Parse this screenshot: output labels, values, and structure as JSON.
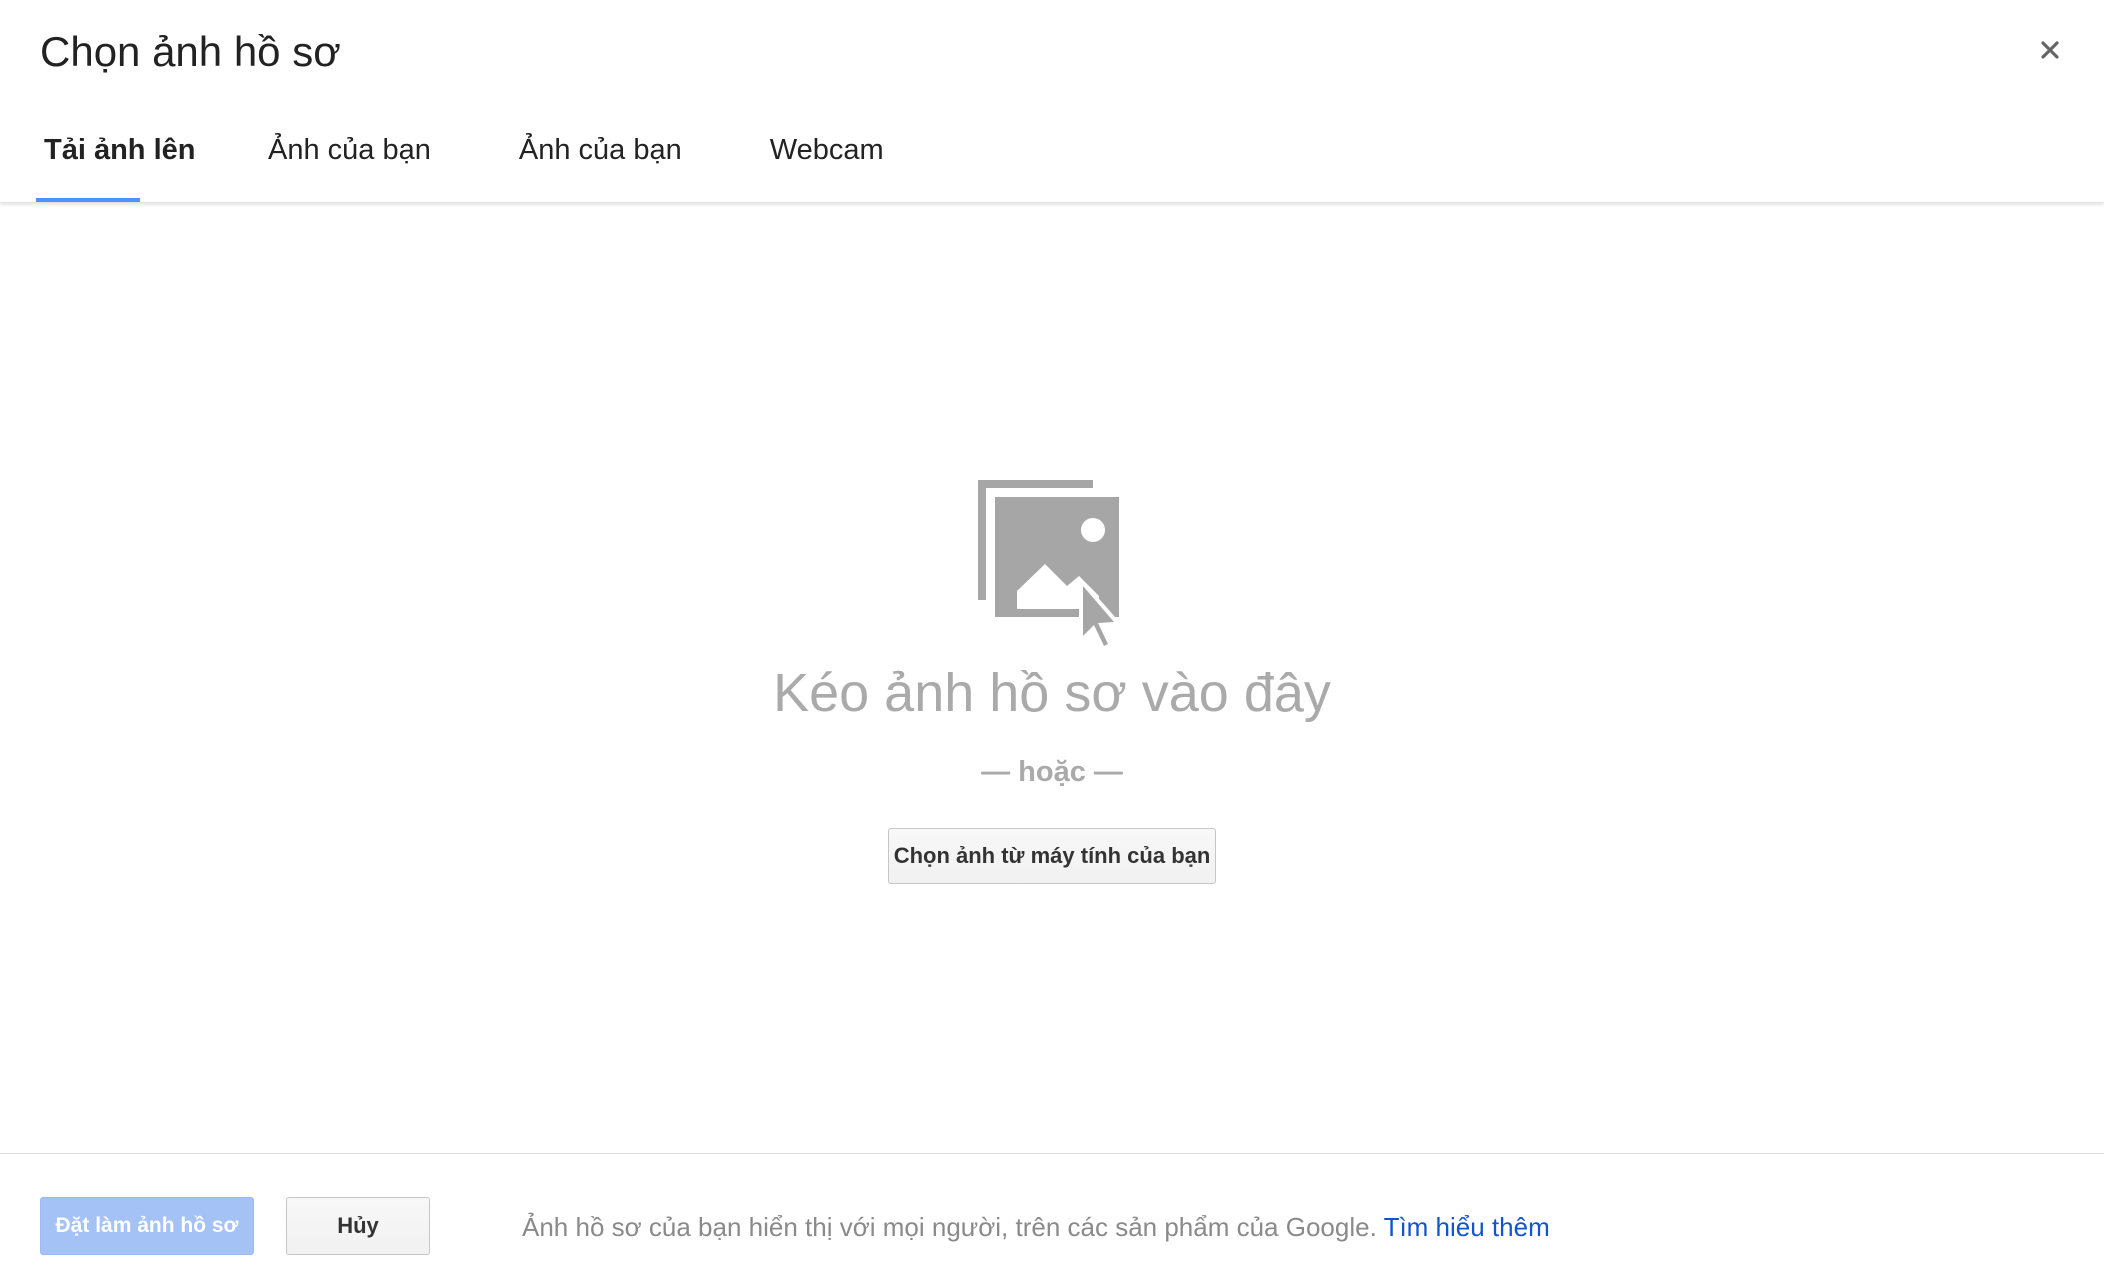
{
  "dialog": {
    "title": "Chọn ảnh hồ sơ",
    "close_icon": "close-icon"
  },
  "tabs": [
    {
      "label": "Tải ảnh lên",
      "active": true
    },
    {
      "label": "Ảnh của bạn",
      "active": false
    },
    {
      "label": "Ảnh của bạn",
      "active": false
    },
    {
      "label": "Webcam",
      "active": false
    }
  ],
  "dropzone": {
    "icon": "photo-drop-icon",
    "title": "Kéo ảnh hồ sơ vào đây",
    "or_text": "— hoặc —",
    "choose_button_label": "Chọn ảnh từ máy tính của bạn"
  },
  "footer": {
    "set_button_label": "Đặt làm ảnh hồ sơ",
    "cancel_button_label": "Hủy",
    "note": "Ảnh hồ sơ của bạn hiển thị với mọi người, trên các sản phẩm của Google.",
    "learn_more_label": "Tìm hiểu thêm"
  },
  "colors": {
    "accent": "#4d90fe",
    "primary_disabled": "#a5c2f6",
    "link": "#1155cc",
    "muted_text": "#aaaaaa",
    "icon_gray": "#a6a6a6"
  }
}
